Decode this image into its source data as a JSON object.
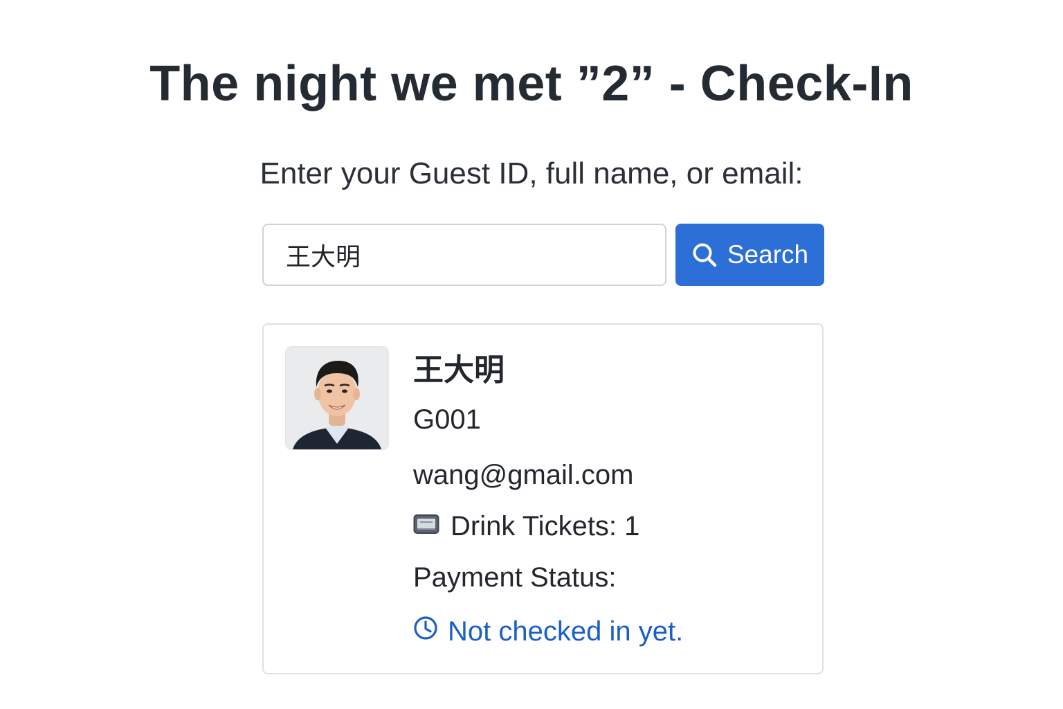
{
  "page": {
    "title": "The night we met ”2” - Check-In",
    "prompt": "Enter your Guest ID, full name, or email:"
  },
  "search": {
    "value": "王大明",
    "button_label": "Search",
    "button_icon": "search-icon"
  },
  "guest": {
    "name": "王大明",
    "guest_id": "G001",
    "email": "wang@gmail.com",
    "drink_icon": "ticket-icon",
    "drink_tickets_text": "Drink Tickets: 1",
    "payment_status_label": "Payment Status:",
    "status_icon": "clock-icon",
    "status_text": "Not checked in yet."
  },
  "colors": {
    "primary": "#2c6fd6",
    "status": "#1a5fc8",
    "text": "#212529",
    "border": "#dee2e6"
  }
}
